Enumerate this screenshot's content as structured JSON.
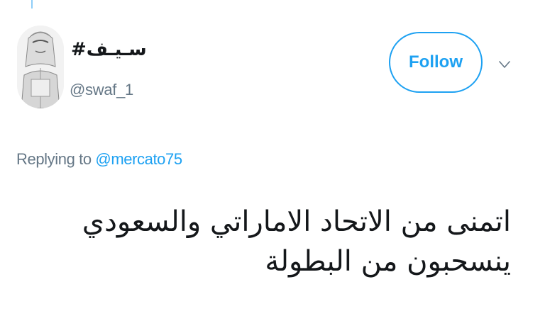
{
  "tweet": {
    "author": {
      "display_name": "سـيـف#",
      "handle": "@swaf_1",
      "avatar_icon": "profile-photo"
    },
    "follow_label": "Follow",
    "menu_icon": "chevron-down-icon",
    "reply_prefix": "Replying to",
    "reply_mention": "@mercato75",
    "text": "اتمنى من الاتحاد الاماراتي والسعودي ينسحبون من البطولة"
  },
  "colors": {
    "accent": "#1da1f2",
    "secondary_text": "#657786",
    "primary_text": "#14171a"
  }
}
